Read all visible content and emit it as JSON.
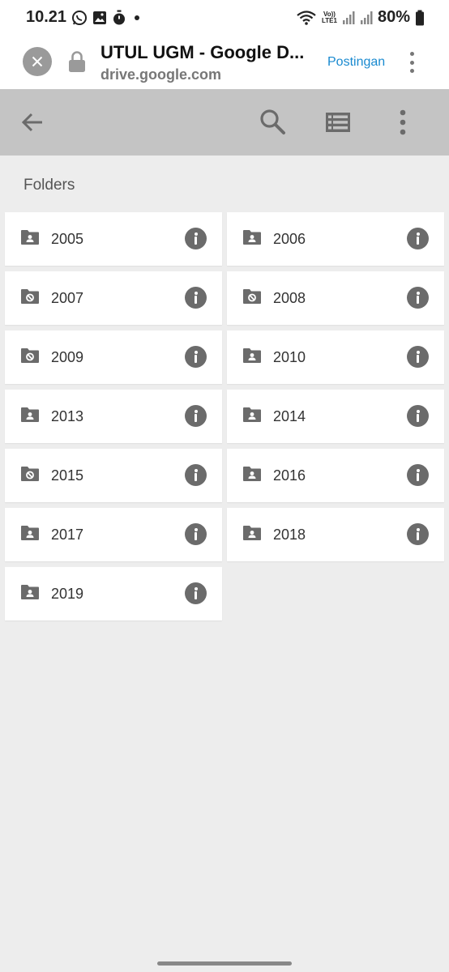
{
  "status_bar": {
    "time": "10.21",
    "volte_top": "Vo))",
    "volte_bottom": "LTE1",
    "battery": "80%",
    "left_icons": [
      "whatsapp-icon",
      "gallery-icon",
      "timer-icon",
      "dot-icon"
    ],
    "right_icons": [
      "wifi-icon",
      "signal-icon",
      "signal-icon",
      "battery-icon"
    ]
  },
  "browser_header": {
    "title": "UTUL UGM - Google D...",
    "url": "drive.google.com",
    "action_label": "Postingan",
    "icons": [
      "close-icon",
      "lock-icon",
      "more-vert-icon"
    ],
    "link_color": "#1a8ad0"
  },
  "toolbar": {
    "icons": [
      "back-arrow-icon",
      "search-icon",
      "list-view-icon",
      "more-vert-icon"
    ],
    "background": "#c4c4c4"
  },
  "content": {
    "section_title": "Folders",
    "folders": [
      {
        "name": "2005",
        "type": "shared"
      },
      {
        "name": "2006",
        "type": "shared"
      },
      {
        "name": "2007",
        "type": "restricted"
      },
      {
        "name": "2008",
        "type": "restricted"
      },
      {
        "name": "2009",
        "type": "restricted"
      },
      {
        "name": "2010",
        "type": "shared"
      },
      {
        "name": "2013",
        "type": "shared"
      },
      {
        "name": "2014",
        "type": "shared"
      },
      {
        "name": "2015",
        "type": "restricted"
      },
      {
        "name": "2016",
        "type": "shared"
      },
      {
        "name": "2017",
        "type": "shared"
      },
      {
        "name": "2018",
        "type": "shared"
      },
      {
        "name": "2019",
        "type": "shared"
      }
    ]
  }
}
